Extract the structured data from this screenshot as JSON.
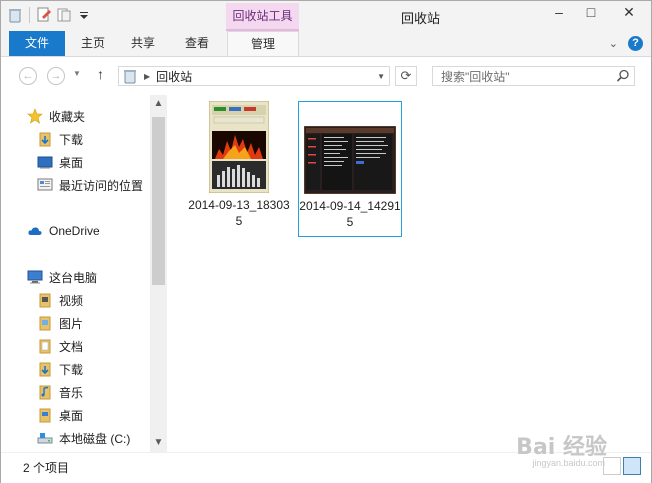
{
  "window": {
    "title": "回收站",
    "context_tab": "回收站工具"
  },
  "ribbon": {
    "tabs": [
      "文件",
      "主页",
      "共享",
      "查看",
      "管理"
    ]
  },
  "address": {
    "path": "回收站"
  },
  "search": {
    "placeholder": "搜索\"回收站\""
  },
  "nav": {
    "favorites": "收藏夹",
    "fav_items": [
      "下载",
      "桌面",
      "最近访问的位置"
    ],
    "onedrive": "OneDrive",
    "this_pc": "这台电脑",
    "pc_items": [
      "视频",
      "图片",
      "文档",
      "下载",
      "音乐",
      "桌面",
      "本地磁盘 (C:)"
    ]
  },
  "files": [
    {
      "name": "2014-09-13_183035"
    },
    {
      "name": "2014-09-14_142915"
    }
  ],
  "status": {
    "count": "2 个项目"
  },
  "watermark": {
    "brand": "Bai 经验",
    "url": "jingyan.baidu.com"
  }
}
